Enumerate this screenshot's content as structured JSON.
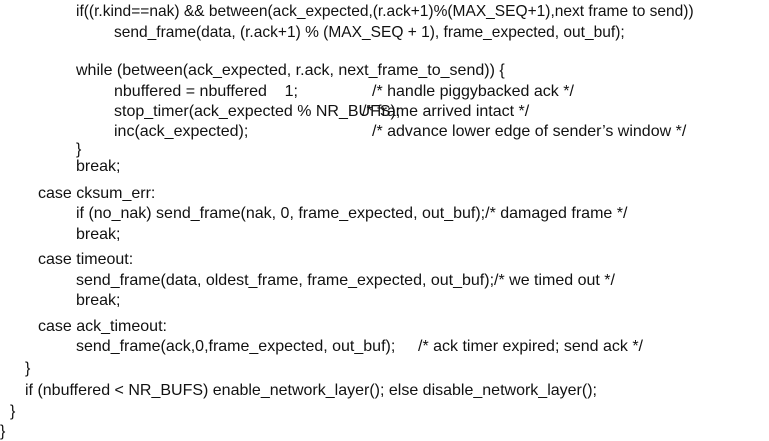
{
  "code_lines": [
    "if((r.kind==nak) && between(ack_expected,(r.ack+1)%(MAX_SEQ+1),next frame to send))",
    "send_frame(data, (r.ack+1) % (MAX_SEQ + 1), frame_expected, out_buf);",
    "while (between(ack_expected, r.ack, next_frame_to_send)) {",
    "nbuffered = nbuffered    1;",
    "stop_timer(ack_expected % NR_BUFS);",
    "inc(ack_expected);",
    "}",
    "break;",
    "case cksum_err:",
    "if (no_nak) send_frame(nak, 0, frame_expected, out_buf);/* damaged frame */",
    "break;",
    "case timeout:",
    "send_frame(data, oldest_frame, frame_expected, out_buf);/* we timed out */",
    "break;",
    "case ack_timeout:",
    "send_frame(ack,0,frame_expected, out_buf);",
    "}",
    "if (nbuffered < NR_BUFS) enable_network_layer(); else disable_network_layer();",
    "}",
    "}"
  ],
  "comments": {
    "piggyback": "/* handle piggybacked ack */",
    "intact": "/* frame arrived intact */",
    "advance": "/* advance lower edge of sender’s window */",
    "ack_timer": "/* ack timer expired; send ack */"
  }
}
